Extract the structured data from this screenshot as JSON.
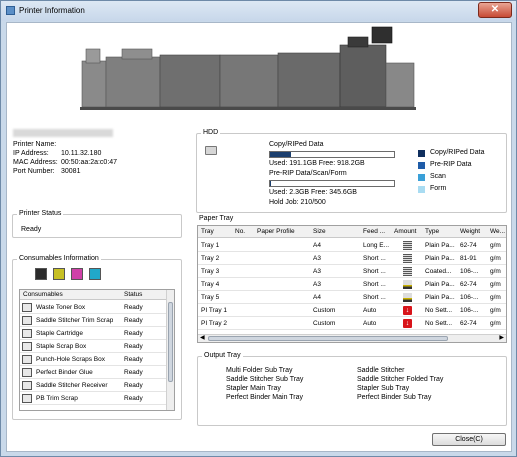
{
  "window": {
    "title": "Printer Information",
    "close_symbol": "✕"
  },
  "printer": {
    "labels": {
      "name": "Printer Name:",
      "ip": "IP Address:",
      "mac": "MAC Address:",
      "port": "Port Number:"
    },
    "ip": "10.11.32.180",
    "mac": "00:50:aa:2a:c0:47",
    "port": "30081"
  },
  "printer_status": {
    "title": "Printer Status",
    "value": "Ready"
  },
  "consumables": {
    "title": "Consumables Information",
    "toner_colors": [
      "#2b2b2b",
      "#c7c024",
      "#d040a8",
      "#21a8c9"
    ],
    "columns": [
      "Consumables",
      "Status"
    ],
    "rows": [
      {
        "name": "Waste Toner Box",
        "status": "Ready",
        "icon": "waste-toner-icon"
      },
      {
        "name": "Saddle Stitcher Trim Scrap",
        "status": "Ready",
        "icon": "trim-scrap-icon"
      },
      {
        "name": "Staple Cartridge",
        "status": "Ready",
        "icon": "staple-icon"
      },
      {
        "name": "Staple Scrap Box",
        "status": "Ready",
        "icon": "scrap-box-icon"
      },
      {
        "name": "Punch-Hole Scraps Box",
        "status": "Ready",
        "icon": "punch-icon"
      },
      {
        "name": "Perfect Binder Glue",
        "status": "Ready",
        "icon": "glue-icon"
      },
      {
        "name": "Saddle Stitcher Receiver",
        "status": "Ready",
        "icon": "receiver-icon"
      },
      {
        "name": "PB Trim Scrap",
        "status": "Ready",
        "icon": "pb-scrap-icon"
      }
    ]
  },
  "hdd": {
    "title": "HDD",
    "copy_label": "Copy/RIPed Data",
    "copy_used": "Used: 191.1GB Free: 918.2GB",
    "copy_fraction": 0.17,
    "prerip_label": "Pre-RIP Data/Scan/Form",
    "prerip_used": "Used: 2.3GB Free: 345.6GB",
    "prerip_fraction": 0.01,
    "hold_job": "Hold Job: 210/500",
    "legend": [
      {
        "label": "Copy/RIPed Data",
        "color": "#0f2f5e"
      },
      {
        "label": "Pre-RIP Data",
        "color": "#1f5ca8"
      },
      {
        "label": "Scan",
        "color": "#3aa0d8"
      },
      {
        "label": "Form",
        "color": "#a9dcf2"
      }
    ]
  },
  "paper_tray": {
    "title": "Paper Tray",
    "columns": [
      "Tray",
      "No.",
      "Paper Profile",
      "Size",
      "Feed ...",
      "Amount",
      "Type",
      "Weight",
      "We..."
    ],
    "rows": [
      {
        "tray": "Tray 1",
        "no": "",
        "profile": "",
        "size": "A4",
        "feed": "Long E...",
        "amount": "full",
        "type": "Plain Pa...",
        "weight": "62-74",
        "we": "g/m"
      },
      {
        "tray": "Tray 2",
        "no": "",
        "profile": "",
        "size": "A3",
        "feed": "Short ...",
        "amount": "full",
        "type": "Plain Pa...",
        "weight": "81-91",
        "we": "g/m"
      },
      {
        "tray": "Tray 3",
        "no": "",
        "profile": "",
        "size": "A3",
        "feed": "Short ...",
        "amount": "full",
        "type": "Coated...",
        "weight": "106-...",
        "we": "g/m"
      },
      {
        "tray": "Tray 4",
        "no": "",
        "profile": "",
        "size": "A3",
        "feed": "Short ...",
        "amount": "low",
        "type": "Plain Pa...",
        "weight": "62-74",
        "we": "g/m"
      },
      {
        "tray": "Tray 5",
        "no": "",
        "profile": "",
        "size": "A4",
        "feed": "Short ...",
        "amount": "low",
        "type": "Plain Pa...",
        "weight": "106-...",
        "we": "g/m"
      },
      {
        "tray": "PI Tray 1",
        "no": "",
        "profile": "",
        "size": "Custom",
        "feed": "Auto",
        "amount": "empty",
        "type": "No Sett...",
        "weight": "106-...",
        "we": "g/m"
      },
      {
        "tray": "PI Tray 2",
        "no": "",
        "profile": "",
        "size": "Custom",
        "feed": "Auto",
        "amount": "empty",
        "type": "No Sett...",
        "weight": "62-74",
        "we": "g/m"
      }
    ]
  },
  "output_tray": {
    "title": "Output Tray",
    "left": [
      "Multi Folder Sub Tray",
      "Saddle Stitcher Sub Tray",
      "Stapler Main Tray",
      "Perfect Binder Main Tray"
    ],
    "right": [
      "Saddle Stitcher",
      "Saddle Stitcher Folded Tray",
      "Stapler Sub Tray",
      "Perfect Binder Sub Tray"
    ]
  },
  "buttons": {
    "close": "Close(C)"
  }
}
